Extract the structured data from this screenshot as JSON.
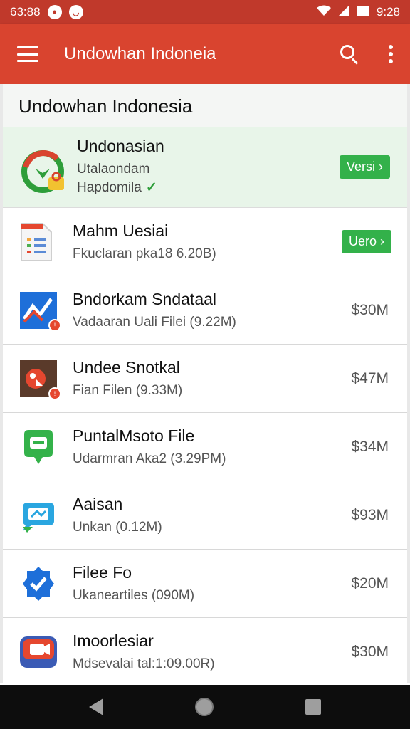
{
  "status_bar": {
    "time_left": "63:88",
    "time_right": "9:28"
  },
  "app_bar": {
    "title": "Undowhan Indoneia"
  },
  "section": {
    "title": "Undowhan Indonesia"
  },
  "featured": {
    "name": "Undonasian",
    "line1": "Utalaondam",
    "line2": "Hapdomila",
    "check_glyph": "✓",
    "button_label": "Versi ›"
  },
  "items": [
    {
      "name": "Mahm Uesiai",
      "sub": "Fkuclaran pka18 6.20B)",
      "button_label": "Uero ›",
      "icon": "document-icon"
    },
    {
      "name": "Bndorkam Sndataal",
      "sub": "Vadaaran Uali Filei (9.22M)",
      "size": "$30M",
      "icon": "chart-icon"
    },
    {
      "name": "Undee Snotkal",
      "sub": "Fian Filen (9.33M)",
      "size": "$47M",
      "icon": "photo-icon"
    },
    {
      "name": "PuntalMsoto File",
      "sub": "Udarmran Aka2 (3.29PM)",
      "size": "$34M",
      "icon": "chat-icon"
    },
    {
      "name": "Aaisan",
      "sub": "Unkan (0.12M)",
      "size": "$93M",
      "icon": "message-icon"
    },
    {
      "name": "Filee Fo",
      "sub": "Ukaneartiles (090M)",
      "size": "$20M",
      "icon": "check-badge-icon"
    },
    {
      "name": "Imoorlesiar",
      "sub": "Mdsevalai tal:1:09.00R)",
      "size": "$30M",
      "icon": "video-icon"
    }
  ],
  "colors": {
    "status_bar": "#c0392b",
    "app_bar": "#d9442f",
    "accent_green": "#33b14a"
  }
}
